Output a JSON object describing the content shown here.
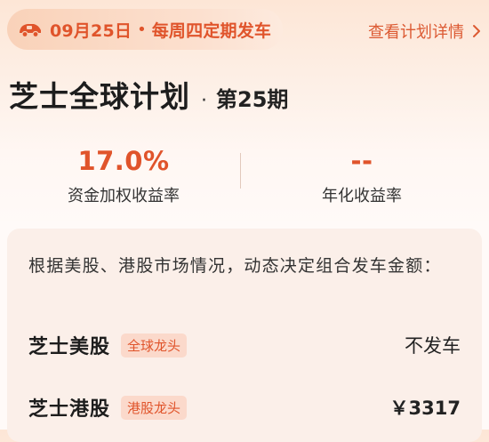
{
  "header": {
    "schedule": {
      "icon": "car-icon",
      "date": "09月25日",
      "separator": "•",
      "cadence": "每周四定期发车"
    },
    "detail_link": {
      "label": "查看计划详情",
      "icon": "chevron-right-icon"
    }
  },
  "plan": {
    "name": "芝士全球计划",
    "separator": "·",
    "period": "第25期"
  },
  "metrics": [
    {
      "value": "17.0%",
      "label": "资金加权收益率"
    },
    {
      "value": "--",
      "label": "年化收益率"
    }
  ],
  "allocation": {
    "description": "根据美股、港股市场情况，动态决定组合发车金额：",
    "rows": [
      {
        "name": "芝士美股",
        "tag": "全球龙头",
        "value": "不发车"
      },
      {
        "name": "芝士港股",
        "tag": "港股龙头",
        "value": "￥3317"
      }
    ]
  },
  "colors": {
    "accent": "#e0542b",
    "pill_bg": "#f9d2b9",
    "card_bg": "#fbefe9",
    "tag_bg": "#fbd9cb"
  }
}
